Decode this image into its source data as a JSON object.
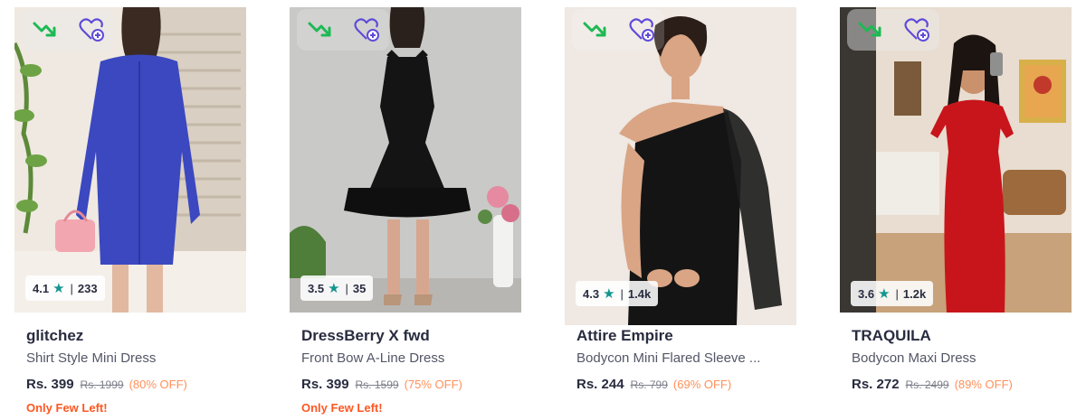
{
  "products": [
    {
      "brand": "glitchez",
      "title": "Shirt Style Mini Dress",
      "rating": "4.1",
      "rating_count": "233",
      "price": "Rs. 399",
      "mrp": "Rs. 1999",
      "discount": "(80% OFF)",
      "stock_note": "Only Few Left!",
      "image": "woman-blue-shirt-dress-photo"
    },
    {
      "brand": "DressBerry X fwd",
      "title": "Front Bow A-Line Dress",
      "rating": "3.5",
      "rating_count": "35",
      "price": "Rs. 399",
      "mrp": "Rs. 1599",
      "discount": "(75% OFF)",
      "stock_note": "Only Few Left!",
      "image": "woman-black-bow-dress-photo"
    },
    {
      "brand": "Attire Empire",
      "title": "Bodycon Mini Flared Sleeve ...",
      "rating": "4.3",
      "rating_count": "1.4k",
      "price": "Rs. 244",
      "mrp": "Rs. 799",
      "discount": "(69% OFF)",
      "stock_note": "",
      "image": "woman-black-one-shoulder-dress-photo"
    },
    {
      "brand": "TRAQUILA",
      "title": "Bodycon Maxi Dress",
      "rating": "3.6",
      "rating_count": "1.2k",
      "price": "Rs. 272",
      "mrp": "Rs. 2499",
      "discount": "(89% OFF)",
      "stock_note": "",
      "image": "woman-red-maxi-dress-photo"
    }
  ],
  "icons": {
    "price_drop": "trending-down-icon",
    "wishlist": "heart-plus-icon",
    "rating_star": "star-icon"
  },
  "colors": {
    "price_drop": "#1db954",
    "wishlist": "#5f4bd8",
    "star": "#14958f",
    "discount": "#ff905a",
    "stock_note": "#ff5722"
  }
}
